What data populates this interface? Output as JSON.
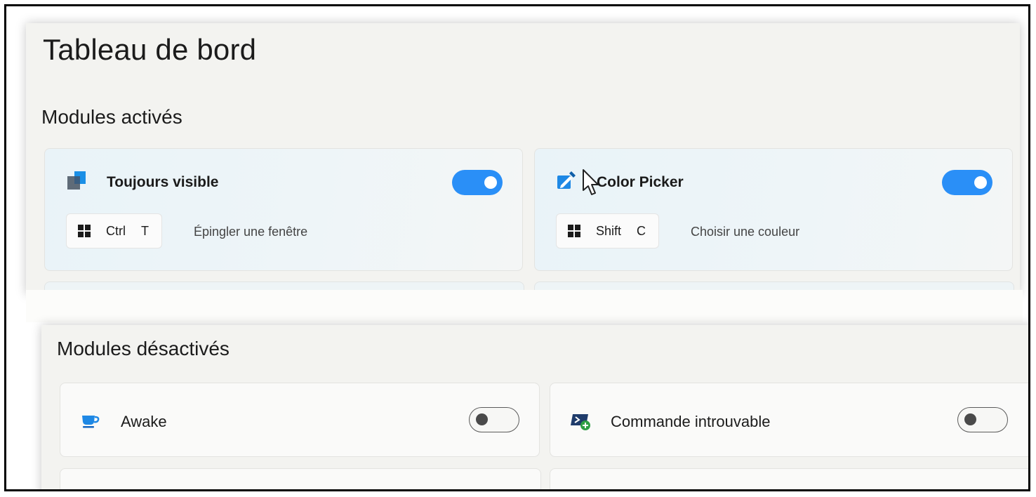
{
  "page": {
    "title": "Tableau de bord"
  },
  "enabled_section": {
    "title": "Modules activés",
    "modules": [
      {
        "name": "Toujours visible",
        "icon": "always-on-top-icon",
        "enabled": true,
        "shortcut": {
          "keys": [
            "Ctrl",
            "T"
          ],
          "description": "Épingler une fenêtre"
        }
      },
      {
        "name": "Color Picker",
        "icon": "color-picker-icon",
        "enabled": true,
        "shortcut": {
          "keys": [
            "Shift",
            "C"
          ],
          "description": "Choisir une couleur"
        }
      }
    ]
  },
  "disabled_section": {
    "title": "Modules désactivés",
    "modules": [
      {
        "name": "Awake",
        "icon": "coffee-cup-icon",
        "enabled": false
      },
      {
        "name": "Commande introuvable",
        "icon": "terminal-plus-icon",
        "enabled": false
      }
    ]
  },
  "colors": {
    "toggle_on": "#2a8ff7",
    "panel_bg": "#f3f3f0",
    "accent_blue": "#1e88e5"
  }
}
